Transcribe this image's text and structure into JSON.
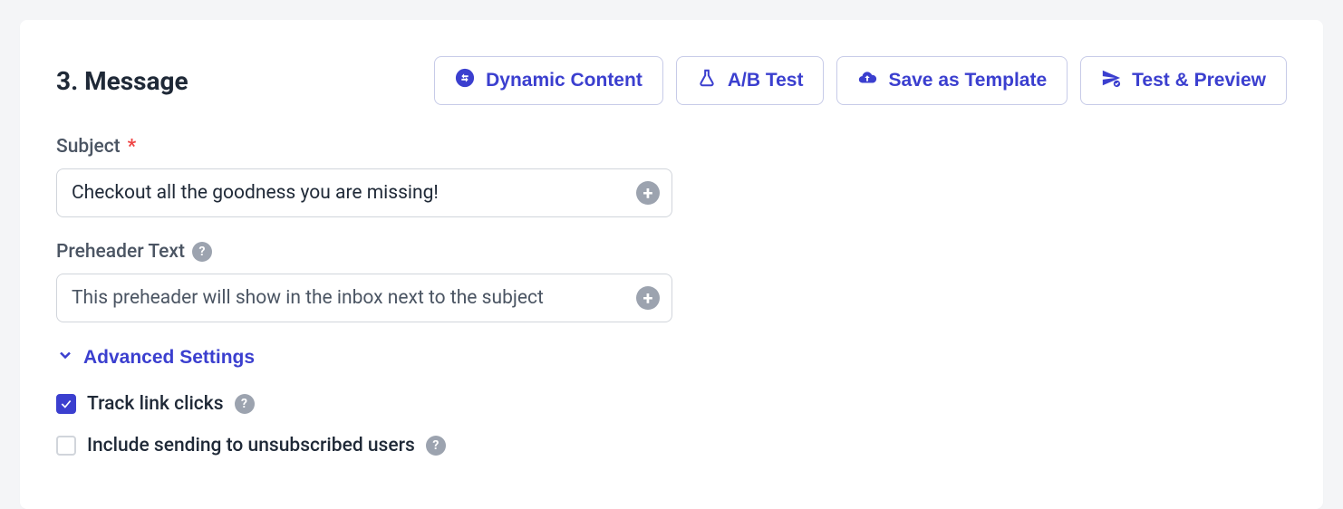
{
  "section": {
    "title": "3. Message"
  },
  "actions": {
    "dynamic_content": "Dynamic Content",
    "ab_test": "A/B Test",
    "save_template": "Save as Template",
    "test_preview": "Test & Preview"
  },
  "fields": {
    "subject": {
      "label": "Subject",
      "required": "*",
      "value": "Checkout all the goodness you are missing!"
    },
    "preheader": {
      "label": "Preheader Text",
      "placeholder": "This preheader will show in the inbox next to the subject",
      "value": ""
    }
  },
  "advanced": {
    "toggle_label": "Advanced Settings",
    "track_links": {
      "label": "Track link clicks",
      "checked": true
    },
    "include_unsub": {
      "label": "Include sending to unsubscribed users",
      "checked": false
    }
  },
  "glyphs": {
    "help": "?",
    "plus": "+"
  }
}
